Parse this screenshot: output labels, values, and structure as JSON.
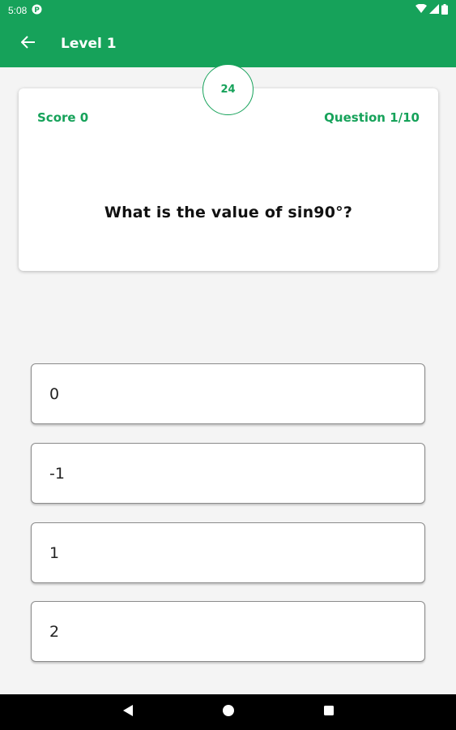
{
  "status_bar": {
    "time": "5:08",
    "icons": [
      "notification-p-icon",
      "wifi-icon",
      "signal-icon",
      "battery-icon"
    ]
  },
  "app_bar": {
    "title": "Level 1",
    "back_icon": "arrow-left-icon"
  },
  "quiz": {
    "timer": "24",
    "score": "Score 0",
    "question_count": "Question 1/10",
    "question": "What is the value of sin90°?",
    "options": [
      "0",
      "-1",
      "1",
      "2"
    ]
  },
  "nav_bar": {
    "icons": [
      "back-triangle-icon",
      "home-circle-icon",
      "recents-square-icon"
    ]
  },
  "colors": {
    "primary": "#16a25a",
    "background": "#f4f4f4",
    "card": "#ffffff"
  }
}
